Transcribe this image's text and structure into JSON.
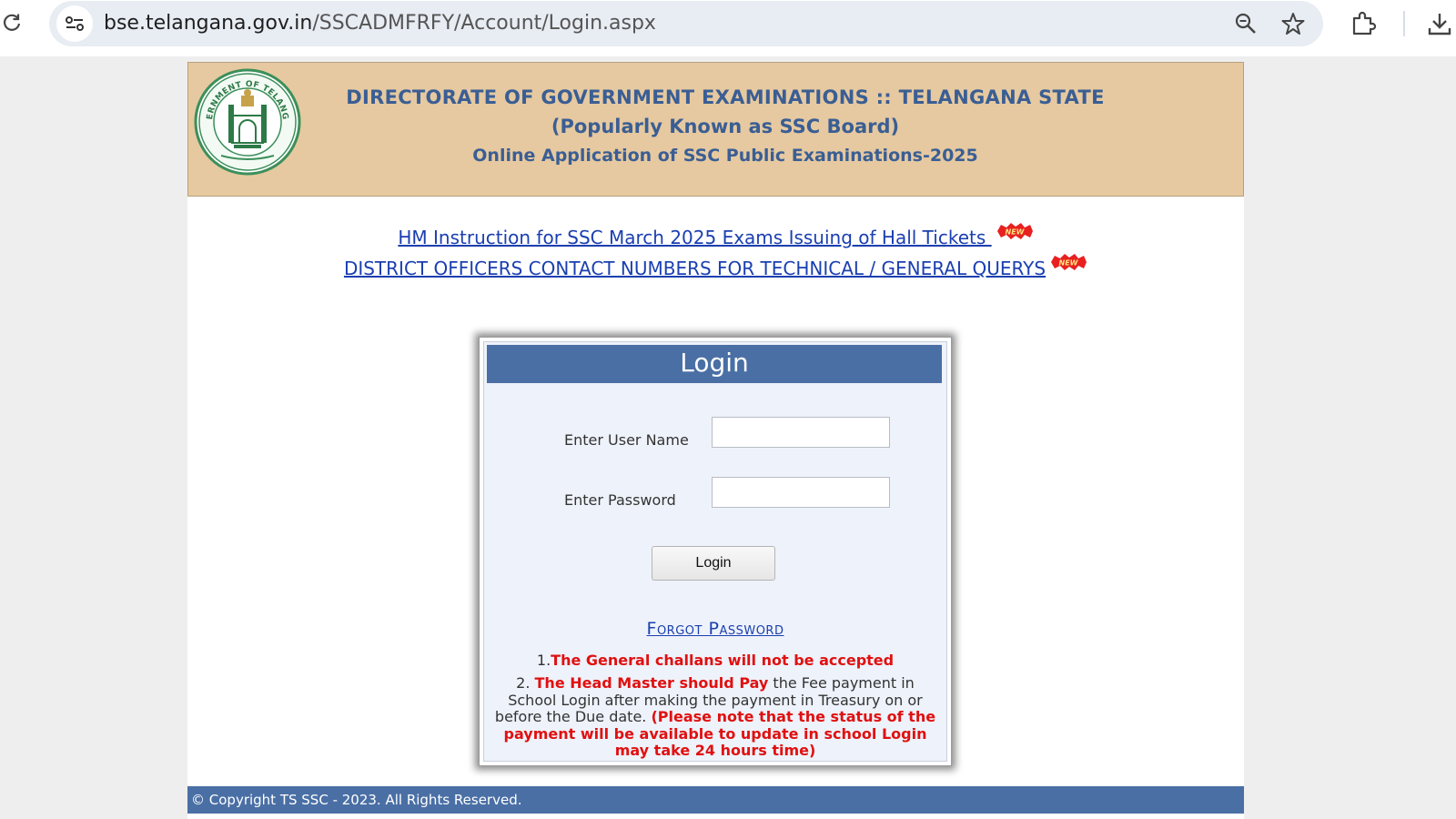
{
  "browser": {
    "url_host": "bse.telangana.gov.in",
    "url_path": "/SSCADMFRFY/Account/Login.aspx",
    "icons": [
      "reload-icon",
      "site-info-icon",
      "zoom-icon",
      "bookmark-star-icon",
      "extensions-icon",
      "download-icon"
    ]
  },
  "header": {
    "line1": "DIRECTORATE OF GOVERNMENT EXAMINATIONS :: TELANGANA STATE",
    "line2": "(Popularly Known as SSC Board)",
    "line3": "Online Application of SSC Public Examinations-2025",
    "emblem_text_top": "GOVERNMENT OF TELANGANA"
  },
  "notices": [
    {
      "text": "HM Instruction for SSC March 2025 Exams Issuing of Hall Tickets ",
      "badge": "NEW"
    },
    {
      "text": "DISTRICT OFFICERS CONTACT NUMBERS FOR TECHNICAL / GENERAL QUERYS",
      "badge": "NEW"
    }
  ],
  "login": {
    "title": "Login",
    "username_label": "Enter User Name",
    "username_value": "",
    "password_label": "Enter Password",
    "password_value": "",
    "button_label": "Login",
    "forgot_label": "Forgot Password"
  },
  "notes": {
    "n1_prefix": "1.",
    "n1_red": "The General challans will not be accepted",
    "n2_prefix": "2. ",
    "n2_red1": "The Head Master should Pay",
    "n2_body": " the Fee payment in School Login after making the payment in Treasury on or before the Due date. ",
    "n2_red2": "(Please note that the status of the payment will be available to update in school Login may take 24 hours time)"
  },
  "footer": {
    "text": "© Copyright TS SSC - 2023. All Rights Reserved."
  },
  "colors": {
    "banner_bg": "#e6c9a0",
    "banner_text": "#3a5e94",
    "header_blue": "#4a6fa5",
    "link_blue": "#1a3fb0",
    "warning_red": "#e01010"
  }
}
